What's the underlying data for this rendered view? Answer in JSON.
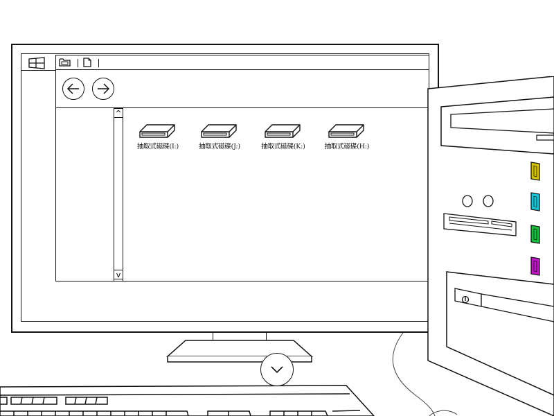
{
  "desktop": {
    "start_icon": "windows-start-icon"
  },
  "explorer": {
    "titlebar_icons": [
      "folder-icon",
      "divider-icon",
      "new-file-icon",
      "divider-icon"
    ],
    "nav": {
      "back_icon": "arrow-left-icon",
      "forward_icon": "arrow-right-icon"
    },
    "scrollbar": {
      "up_label": "^",
      "down_label": "v"
    },
    "drives": [
      {
        "label": "抽取式磁碟(I:)",
        "icon": "removable-drive-icon"
      },
      {
        "label": "抽取式磁碟(J:)",
        "icon": "removable-drive-icon"
      },
      {
        "label": "抽取式磁碟(K:)",
        "icon": "removable-drive-icon"
      },
      {
        "label": "抽取式磁碟(H:)",
        "icon": "removable-drive-icon"
      }
    ]
  },
  "stand": {
    "chevron_icon": "chevron-down-icon"
  },
  "pc_tower": {
    "usb_port_colors": [
      "#d4c400",
      "#18c8d8",
      "#18c040",
      "#c018c8"
    ]
  },
  "colors": {
    "line": "#111111",
    "background": "#ffffff"
  }
}
